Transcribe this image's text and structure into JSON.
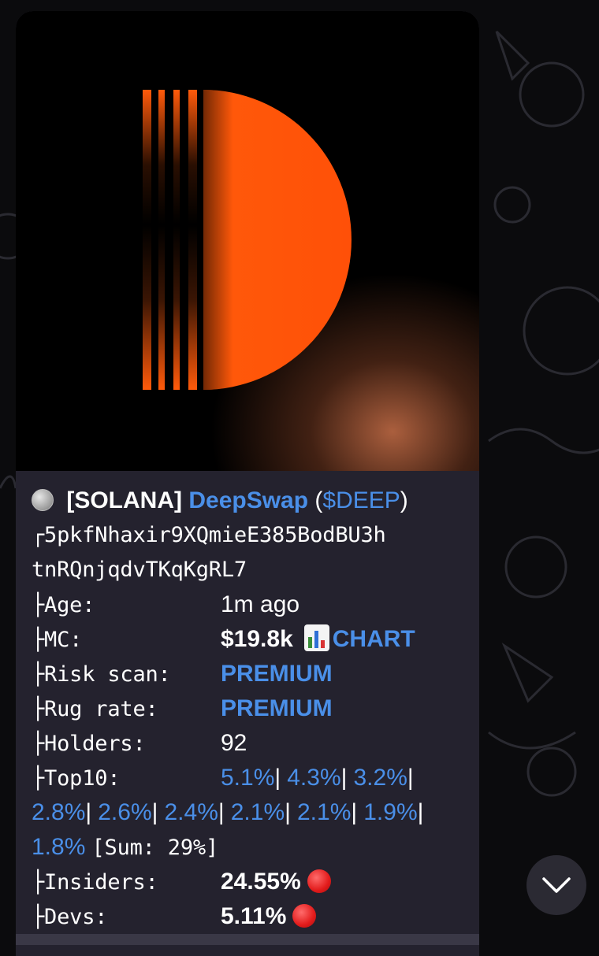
{
  "message": {
    "header": {
      "coin_icon": "silver-coin-icon",
      "chain": "[SOLANA]",
      "token_name": "DeepSwap",
      "open_paren": " (",
      "ticker": "$DEEP",
      "close_paren": ")"
    },
    "address_line1": "┌5pkfNhaxir9XQmieE385BodBU3h",
    "address_line2": "tnRQnjqdvTKqKgRL7",
    "age": {
      "label": "├Age:",
      "value": "1m ago"
    },
    "mc": {
      "label": "├MC:",
      "value": "$19.8k",
      "chart_icon": "bar-chart-icon",
      "chart_link": "CHART"
    },
    "risk_scan": {
      "label": "├Risk scan:",
      "value": "PREMIUM"
    },
    "rug_rate": {
      "label": "├Rug rate:",
      "value": "PREMIUM"
    },
    "holders": {
      "label": "├Holders:",
      "value": "92"
    },
    "top10": {
      "label": "├Top10:",
      "values": [
        "5.1%",
        "4.3%",
        "3.2%",
        "2.8%",
        "2.6%",
        "2.4%",
        "2.1%",
        "2.1%",
        "1.9%",
        "1.8%"
      ],
      "sep": "|",
      "sum": "[Sum: 29%]"
    },
    "insiders": {
      "label": "├Insiders:",
      "value": "24.55%",
      "icon": "red-circle-icon"
    },
    "devs": {
      "label": "├Devs:",
      "value": "5.11%",
      "icon": "red-circle-icon"
    }
  },
  "colors": {
    "link": "#4a8fe8",
    "bubble": "#24222e",
    "logo_orange": "#ff5a0a"
  }
}
